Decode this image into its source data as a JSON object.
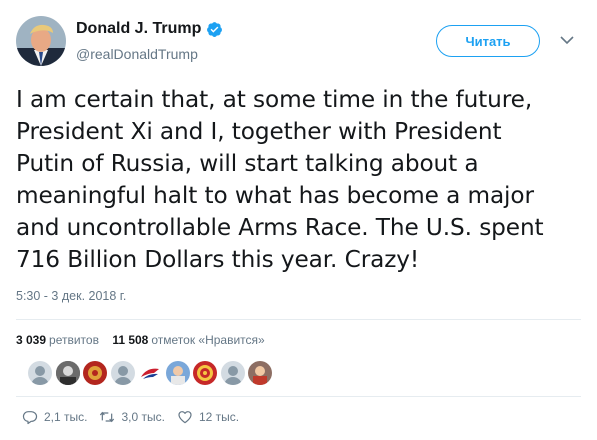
{
  "author": {
    "display_name": "Donald J. Trump",
    "handle": "@realDonaldTrump",
    "verified_icon": "verified-badge-icon",
    "avatar": "profile-photo"
  },
  "follow_label": "Читать",
  "tweet": {
    "lines": [
      "I am certain that, at some time in the future,",
      "President Xi and I, together with President",
      "Putin of Russia, will start talking about a",
      "meaningful halt to what has become a major",
      "and uncontrollable Arms Race. The U.S. spent",
      "716 Billion Dollars this year. Crazy!"
    ]
  },
  "timestamp": "5:30 - 3 дек. 2018 г.",
  "stats": {
    "retweets_count": "3 039",
    "retweets_label": "ретвитов",
    "likes_count": "11 508",
    "likes_label": "отметок «Нравится»"
  },
  "actions": {
    "replies": "2,1 тыс.",
    "retweets": "3,0 тыс.",
    "likes": "12 тыс."
  },
  "colors": {
    "accent": "#1da1f2",
    "text": "#14171a",
    "secondary": "#657786",
    "divider": "#e6ecf0"
  },
  "icons": [
    "chevron-down-icon",
    "reply-icon",
    "retweet-icon",
    "heart-icon"
  ]
}
